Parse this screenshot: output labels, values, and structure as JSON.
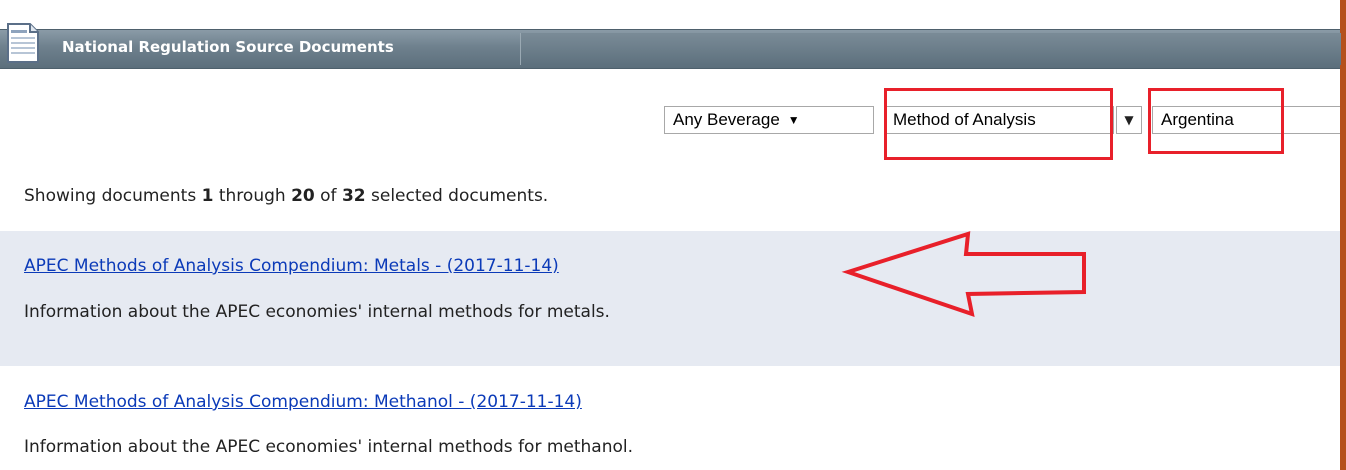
{
  "panel": {
    "title": "National Regulation Source Documents",
    "icon": "document-icon"
  },
  "filters": {
    "beverage": "Any Beverage",
    "topic": "Method of Analysis",
    "country": "Argentina",
    "arrow_glyph": "▼"
  },
  "results": {
    "prefix": "Showing documents",
    "start": "1",
    "through": "through",
    "end": "20",
    "of": "of",
    "total": "32",
    "suffix": "selected documents."
  },
  "documents": [
    {
      "title": "APEC Methods of Analysis Compendium: Metals - (2017-11-14)",
      "description": "Information about the APEC economies' internal methods for metals."
    },
    {
      "title": "APEC Methods of Analysis Compendium: Methanol - (2017-11-14)",
      "description": "Information about the APEC economies' internal methods for methanol."
    }
  ],
  "annotations": {
    "highlight_color": "#e8202a"
  }
}
